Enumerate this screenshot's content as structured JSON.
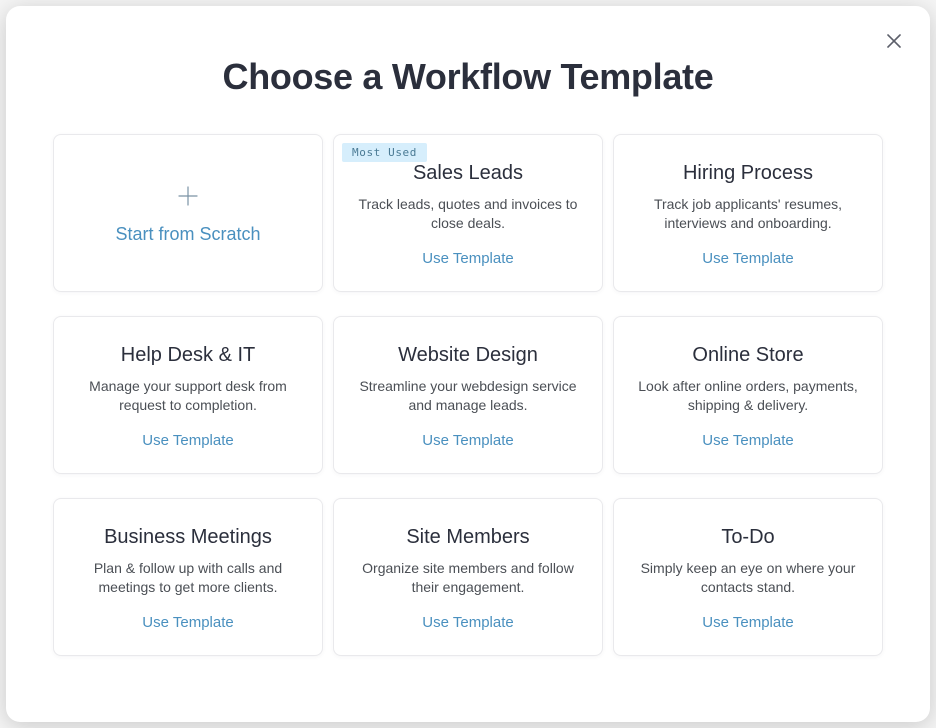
{
  "title": "Choose a Workflow Template",
  "close_label": "Close",
  "scratch": {
    "label": "Start from Scratch"
  },
  "badge_label": "Most Used",
  "use_template_label": "Use Template",
  "templates": [
    {
      "title": "Sales Leads",
      "desc": "Track leads, quotes and invoices to close deals.",
      "badge": true
    },
    {
      "title": "Hiring Process",
      "desc": "Track job applicants' resumes, interviews and onboarding.",
      "badge": false
    },
    {
      "title": "Help Desk & IT",
      "desc": "Manage your support desk from request to completion.",
      "badge": false
    },
    {
      "title": "Website Design",
      "desc": "Streamline your webdesign service and manage leads.",
      "badge": false
    },
    {
      "title": "Online Store",
      "desc": "Look after online orders, payments, shipping & delivery.",
      "badge": false
    },
    {
      "title": "Business Meetings",
      "desc": "Plan & follow up with calls and meetings to get more clients.",
      "badge": false
    },
    {
      "title": "Site Members",
      "desc": "Organize site members and follow their engagement.",
      "badge": false
    },
    {
      "title": "To-Do",
      "desc": "Simply keep an eye on where your contacts stand.",
      "badge": false
    }
  ]
}
